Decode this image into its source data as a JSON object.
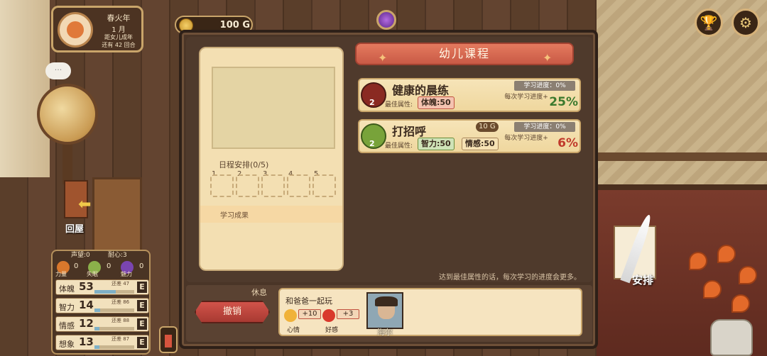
{
  "calendar": {
    "year": "春火年",
    "month": "1 月",
    "note_line1": "距女儿成年",
    "note_line2": "还有 42 回合"
  },
  "gold": {
    "value": "100 G"
  },
  "course_panel": {
    "title": "幼儿课程",
    "courses": [
      {
        "title": "健康的晨练",
        "level": "2",
        "best_attr_label": "最佳属性:",
        "attrs": [
          "体魄:50"
        ],
        "progress_label": "学习进度：0%",
        "per_learn_label": "每次学习进度+",
        "percent": "25%",
        "cost": ""
      },
      {
        "title": "打招呼",
        "level": "2",
        "best_attr_label": "最佳属性:",
        "attrs": [
          "智力:50",
          "情感:50"
        ],
        "progress_label": "学习进度：0%",
        "per_learn_label": "每次学习进度+",
        "percent": "6%",
        "cost": "10 G"
      }
    ],
    "hint": "达到最佳属性的话，每次学习的进度会更多。"
  },
  "schedule": {
    "label": "日程安排(0/5)",
    "slots": [
      "1",
      "2",
      "3",
      "4",
      "5"
    ],
    "result_label": "学习成果"
  },
  "rest": {
    "label": "休息",
    "cancel_label": "撤销",
    "activity_title": "和爸爸一起玩",
    "mood_value": "+10",
    "mood_name": "心情",
    "affection_value": "+3",
    "affection_name": "好感",
    "character_name": "海尔"
  },
  "status": {
    "fame": "声望:0",
    "patience": "耐心:3",
    "points": [
      {
        "name": "力量",
        "value": "0",
        "color": "#d9782c"
      },
      {
        "name": "失眠",
        "value": "0",
        "color": "#8bb04a"
      },
      {
        "name": "魅力",
        "value": "0",
        "color": "#7a45b0"
      }
    ],
    "stats": [
      {
        "name": "体魄",
        "value": "53",
        "note": "还差 47",
        "grade": "E",
        "fill": 0.53
      },
      {
        "name": "智力",
        "value": "14",
        "note": "还差 86",
        "grade": "E",
        "fill": 0.14
      },
      {
        "name": "情感",
        "value": "12",
        "note": "还差 88",
        "grade": "E",
        "fill": 0.12
      },
      {
        "name": "想象",
        "value": "13",
        "note": "还差 87",
        "grade": "E",
        "fill": 0.13
      }
    ]
  },
  "nav": {
    "home_label": "回屋",
    "arrange_label": "安排"
  },
  "icons": {
    "trophy": "trophy-icon",
    "settings": "gear-icon",
    "chat": "chat-bubble-icon"
  }
}
